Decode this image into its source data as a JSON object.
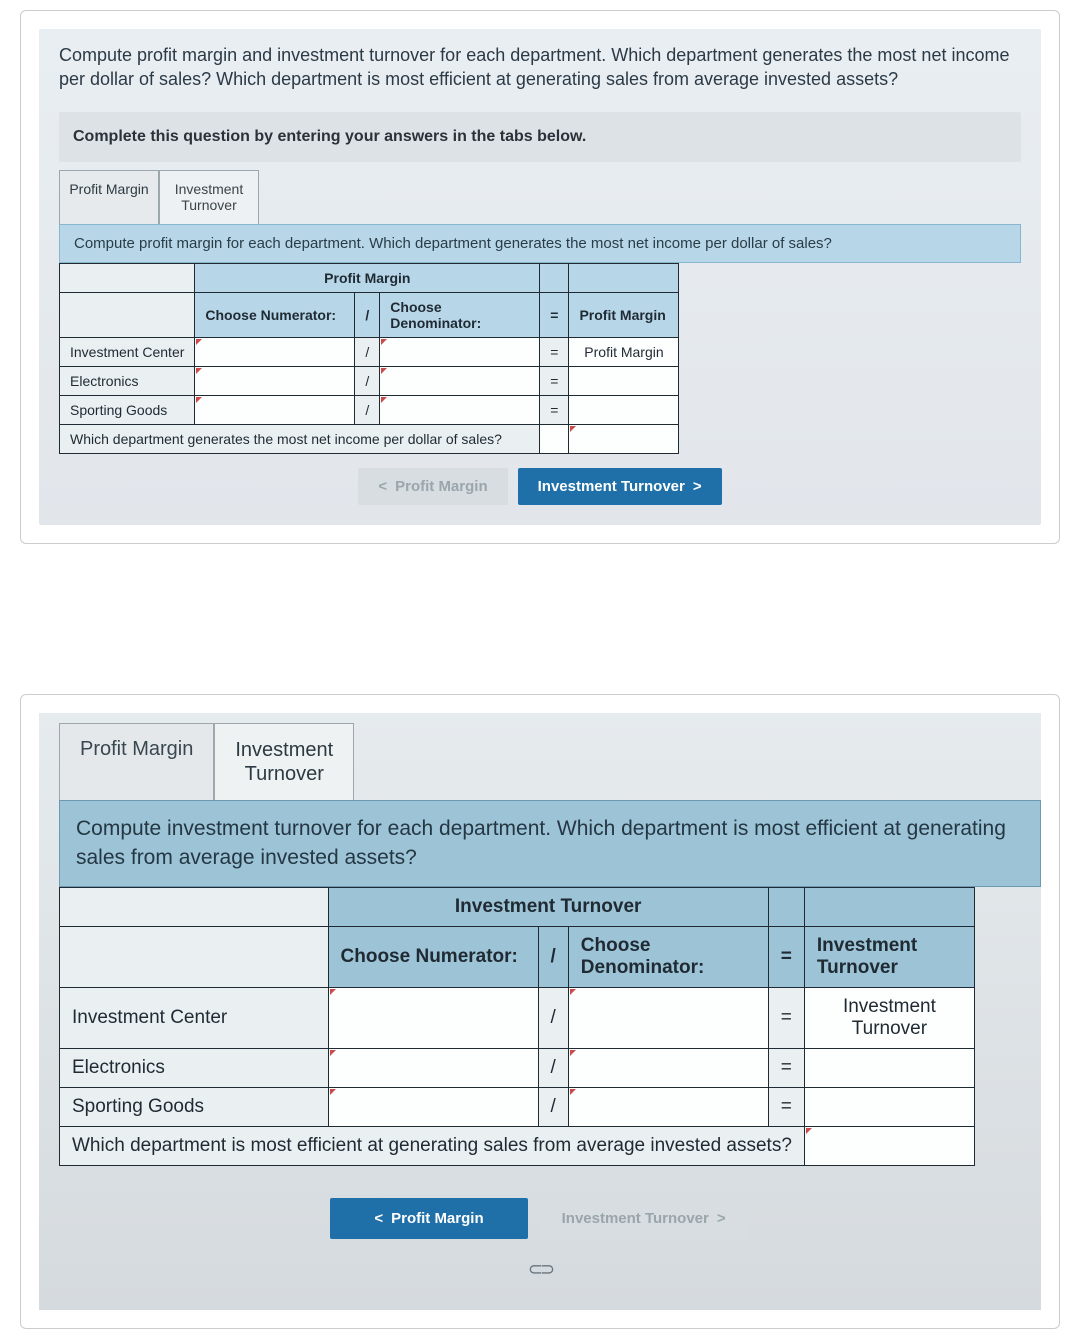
{
  "card1": {
    "question": "Compute profit margin and investment turnover for each department. Which department generates the most net income per dollar of sales? Which department is most efficient at generating sales from average invested assets?",
    "instruction": "Complete this question by entering your answers in the tabs below.",
    "tabs": {
      "pm": "Profit Margin",
      "it": "Investment\nTurnover"
    },
    "sub_instruction": "Compute profit margin for each department. Which department generates the most net income per dollar of sales?",
    "table": {
      "title": "Profit Margin",
      "h_num": "Choose Numerator:",
      "h_denom": "Choose Denominator:",
      "h_result": "Profit Margin",
      "rows": [
        "Investment Center",
        "Electronics",
        "Sporting Goods"
      ],
      "result_first": "Profit Margin",
      "footer_q": "Which department generates the most net income per dollar of sales?"
    },
    "nav": {
      "prev": "Profit Margin",
      "next": "Investment Turnover"
    }
  },
  "card2": {
    "tabs": {
      "pm": "Profit Margin",
      "it": "Investment\nTurnover"
    },
    "sub_instruction": "Compute investment turnover for each department. Which department is most efficient at generating sales from average invested assets?",
    "table": {
      "title": "Investment Turnover",
      "h_num": "Choose Numerator:",
      "h_denom": "Choose Denominator:",
      "h_result": "Investment Turnover",
      "rows": [
        "Investment Center",
        "Electronics",
        "Sporting Goods"
      ],
      "result_first": "Investment Turnover",
      "footer_q": "Which department is most efficient at generating sales from average invested assets?"
    },
    "nav": {
      "prev": "Profit Margin",
      "next": "Investment Turnover"
    }
  },
  "symbols": {
    "div": "/",
    "eq": "=",
    "chev_l": "<",
    "chev_r": ">"
  }
}
